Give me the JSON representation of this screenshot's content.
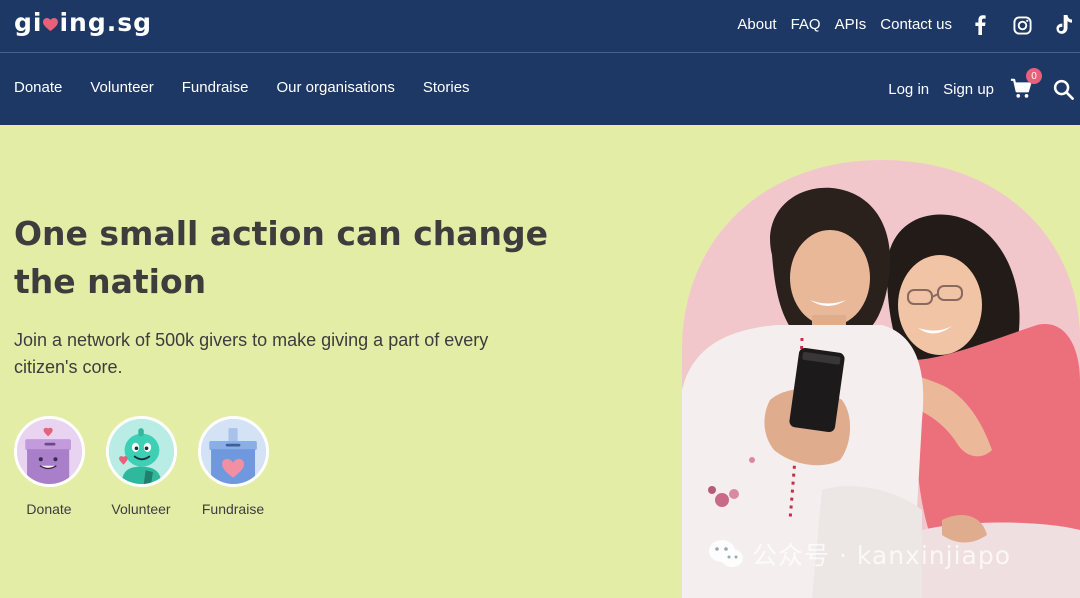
{
  "brand": {
    "logo_prefix": "gi",
    "logo_suffix": "ing.sg"
  },
  "toplinks": [
    "About",
    "FAQ",
    "APIs",
    "Contact us"
  ],
  "social": {
    "facebook_icon": "facebook-icon",
    "instagram_icon": "instagram-icon",
    "tiktok_icon": "tiktok-icon"
  },
  "nav": {
    "items": [
      "Donate",
      "Volunteer",
      "Fundraise",
      "Our organisations",
      "Stories"
    ],
    "login": "Log in",
    "signup": "Sign up",
    "cart_count": "0"
  },
  "hero": {
    "title": "One small action can change the nation",
    "subtitle": "Join a network of 500k givers to make giving a part of every citizen's core."
  },
  "actions": [
    {
      "label": "Donate",
      "icon": "donation-box-icon"
    },
    {
      "label": "Volunteer",
      "icon": "volunteer-character-icon"
    },
    {
      "label": "Fundraise",
      "icon": "fundraise-box-icon"
    }
  ],
  "watermark": "公众号 · kanxinjiapo",
  "colors": {
    "header": "#1d3864",
    "hero_bg": "#e3eda5",
    "accent": "#e8607a"
  }
}
